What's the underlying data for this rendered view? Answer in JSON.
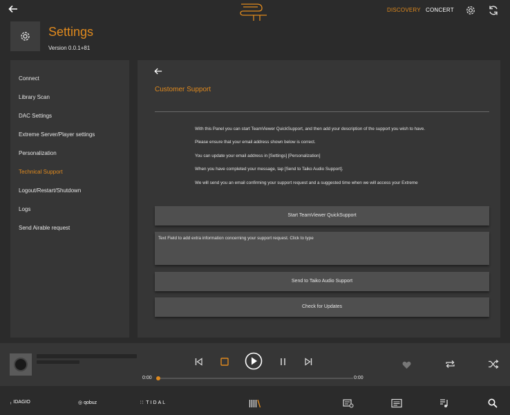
{
  "topbar": {
    "nav_discovery": "DISCOVERY",
    "nav_concert": "CONCERT",
    "accent_color": "#e08a1e"
  },
  "header": {
    "title": "Settings",
    "version": "Version 0.0.1+81"
  },
  "sidebar": {
    "items": [
      {
        "label": "Connect"
      },
      {
        "label": "Library Scan"
      },
      {
        "label": "DAC Settings"
      },
      {
        "label": "Extreme Server/Player settings"
      },
      {
        "label": "Personalization"
      },
      {
        "label": "Technical Support",
        "active": true
      },
      {
        "label": "Logout/Restart/Shutdown"
      },
      {
        "label": "Logs"
      },
      {
        "label": "Send Airable request"
      }
    ]
  },
  "panel": {
    "title": "Customer Support",
    "info_lines": [
      "With this Panel you can start TeamViewer QuickSupport, and then add your description of the support you wish to have.",
      "Please ensure that your email address shown below is correct.",
      "You can update your email address in [Settings] [Personalization]",
      "When you have completed your message, tap [Send to Taiko Audio Support].",
      "We will send you an email confirming your support request and a suggested time when we will access your Extreme"
    ],
    "teamviewer_button": "Start TeamViewer QuickSupport",
    "textfield_placeholder": "Text Field to add extra information concerning your support request. Click to type",
    "send_button": "Send to Taiko Audio Support",
    "updates_button": "Check for Updates"
  },
  "player": {
    "time_elapsed": "0:00",
    "time_total": "0:00",
    "progress": 0
  },
  "bottom_nav": {
    "idagio": "IDAGIO",
    "qobuz": "qobuz",
    "tidal": "TIDAL"
  }
}
